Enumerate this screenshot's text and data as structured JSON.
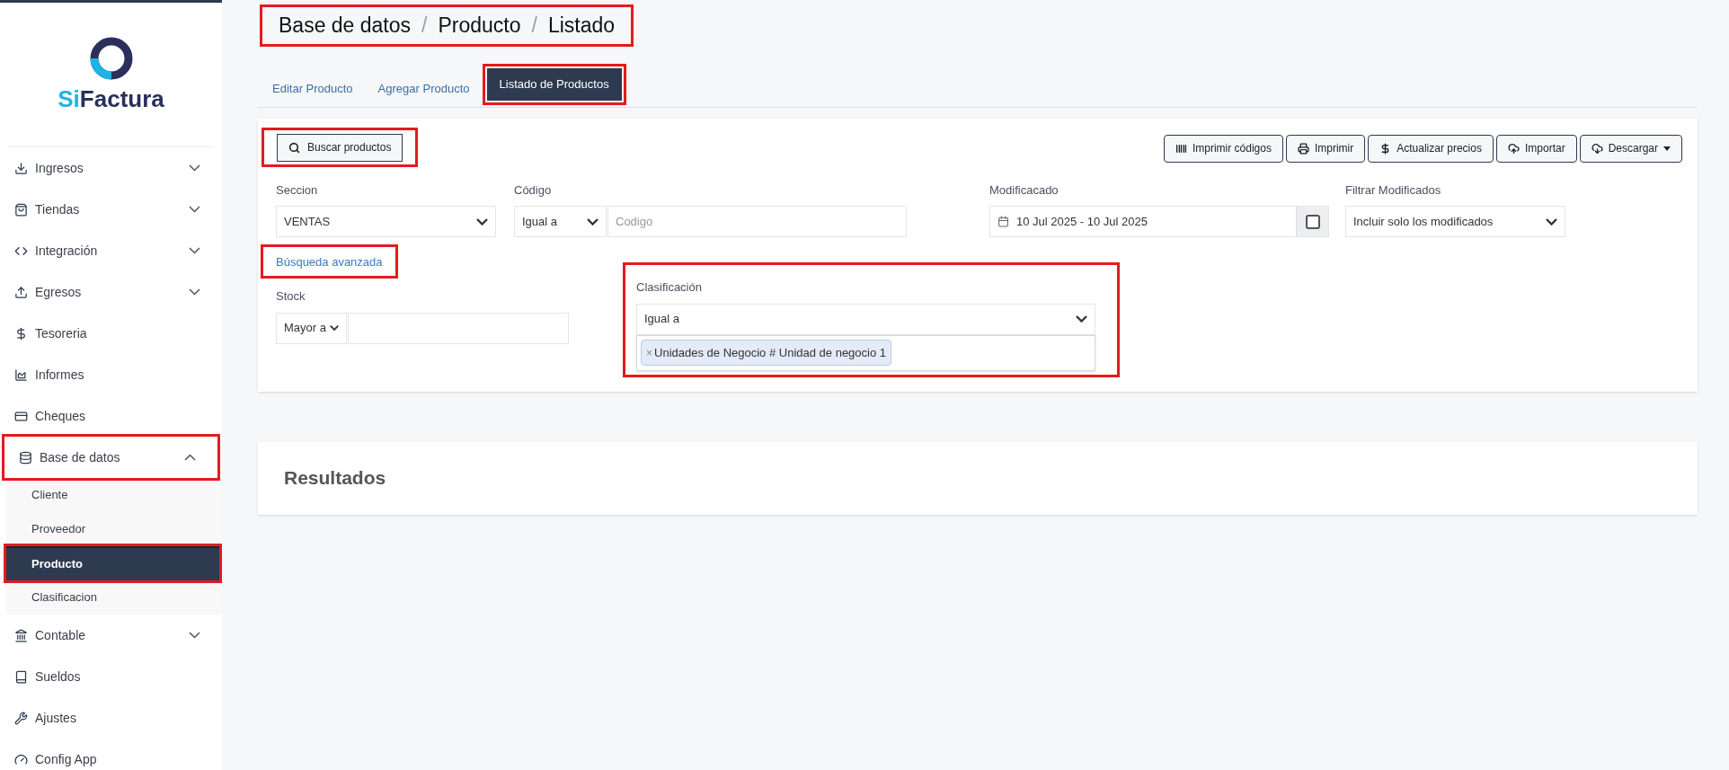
{
  "logo": {
    "prefix": "Si",
    "name": "Factura"
  },
  "sidebar": {
    "items": [
      {
        "label": "Ingresos",
        "expanded": false,
        "highlighted": false
      },
      {
        "label": "Tiendas",
        "expanded": false,
        "highlighted": false
      },
      {
        "label": "Integración",
        "expanded": false,
        "highlighted": false
      },
      {
        "label": "Egresos",
        "expanded": false,
        "highlighted": false
      },
      {
        "label": "Tesoreria",
        "highlighted": false
      },
      {
        "label": "Informes",
        "highlighted": false
      },
      {
        "label": "Cheques",
        "highlighted": false
      },
      {
        "label": "Base de datos",
        "expanded": true,
        "highlighted": true,
        "children": [
          {
            "label": "Cliente",
            "selected": false,
            "highlighted": false
          },
          {
            "label": "Proveedor",
            "selected": false,
            "highlighted": false
          },
          {
            "label": "Producto",
            "selected": true,
            "highlighted": true
          },
          {
            "label": "Clasificacion",
            "selected": false,
            "highlighted": false
          }
        ]
      },
      {
        "label": "Contable",
        "expanded": false,
        "highlighted": false
      },
      {
        "label": "Sueldos",
        "highlighted": false
      },
      {
        "label": "Ajustes",
        "highlighted": false
      },
      {
        "label": "Config App",
        "highlighted": false
      }
    ]
  },
  "breadcrumb": {
    "highlighted": true,
    "separator": "/",
    "items": [
      "Base de datos",
      "Producto",
      "Listado"
    ]
  },
  "tabs": [
    {
      "label": "Editar Producto",
      "selected": false,
      "highlighted": false
    },
    {
      "label": "Agregar Producto",
      "selected": false,
      "highlighted": false
    },
    {
      "label": "Listado de Productos",
      "selected": true,
      "highlighted": true
    }
  ],
  "search_button": {
    "label": "Buscar productos",
    "highlighted": true
  },
  "toolbar": [
    {
      "label": "Imprimir códigos"
    },
    {
      "label": "Imprimir"
    },
    {
      "label": "Actualizar precios"
    },
    {
      "label": "Importar"
    },
    {
      "label": "Descargar"
    }
  ],
  "filters": {
    "seccion": {
      "label": "Seccion",
      "value": "VENTAS"
    },
    "codigo": {
      "label": "Código",
      "operator": "Igual a",
      "placeholder": "Codigo"
    },
    "modificado": {
      "label": "Modificacado",
      "value": "10 Jul 2025 - 10 Jul 2025",
      "checked": false
    },
    "filtrar": {
      "label": "Filtrar Modificados",
      "value": "Incluir solo los modificados"
    }
  },
  "advanced_link": {
    "label": "Búsqueda avanzada",
    "highlighted": true
  },
  "stock": {
    "label": "Stock",
    "operator": "Mayor a"
  },
  "clasificacion": {
    "label": "Clasificación",
    "operator": "Igual a",
    "highlighted": true,
    "tags": [
      "Unidades de Negocio # Unidad de negocio 1"
    ],
    "tag_remove": "×"
  },
  "results": {
    "title": "Resultados"
  }
}
